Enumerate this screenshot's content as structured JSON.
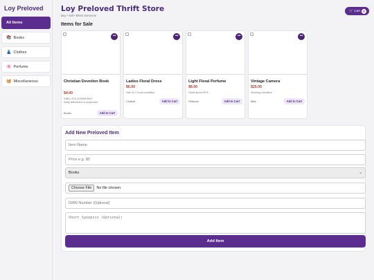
{
  "sidebar": {
    "brand": "Loy Preloved",
    "items": [
      {
        "label": "All Items",
        "icon": ""
      },
      {
        "label": "Books",
        "icon": "📚"
      },
      {
        "label": "Clothes",
        "icon": "👗"
      },
      {
        "label": "Perfume",
        "icon": "🌸"
      },
      {
        "label": "Miscellaneous",
        "icon": "🧺"
      }
    ]
  },
  "header": {
    "title": "Loy Preloved Thrift Store",
    "tagline": "Buy • Sell • Bless Someone",
    "cart_label": "🛒 Cart",
    "cart_count": "0"
  },
  "section_title": "Items for Sale",
  "products": [
    {
      "name": "Christian Devotion Book",
      "price": "$4.00",
      "desc1": "ISBN: 978-1234567890",
      "desc2": "Daily reflections & scriptures",
      "category": "Books",
      "button": "Add to Cart"
    },
    {
      "name": "Ladies Floral Dress",
      "price": "$6.00",
      "desc1": "Size M • Good condition",
      "desc2": "",
      "category": "Clothes",
      "button": "Add to Cart"
    },
    {
      "name": "Light Floral Perfume",
      "price": "$8.00",
      "desc1": "Used about 20%",
      "desc2": "",
      "category": "Perfume",
      "button": "Add to Cart"
    },
    {
      "name": "Vintage Camera",
      "price": "$25.00",
      "desc1": "Working condition",
      "desc2": "",
      "category": "Misc",
      "button": "Add to Cart"
    }
  ],
  "form": {
    "title": "Add New Preloved Item",
    "name_placeholder": "Item Name",
    "price_placeholder": "Price e.g. $5",
    "category_value": "Books",
    "file_button": "Choose File",
    "file_status": "No file chosen",
    "isbn_placeholder": "ISBN Number (Optional)",
    "synopsis_placeholder": "Short Synopsis (Optional)",
    "submit_label": "Add Item"
  },
  "colors": {
    "accent": "#5b2d8e",
    "price": "#c0392b",
    "title": "#4a2c7a"
  }
}
